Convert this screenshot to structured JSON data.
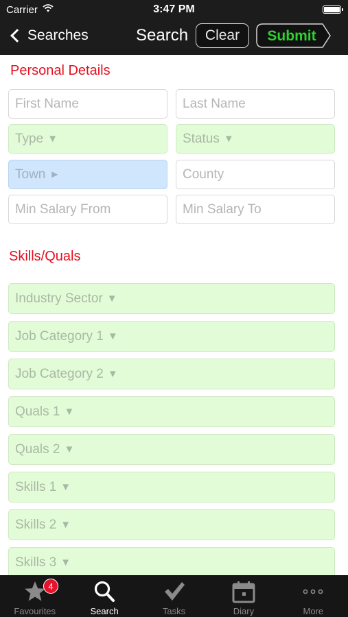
{
  "status_bar": {
    "carrier": "Carrier",
    "time": "3:47 PM"
  },
  "nav": {
    "back_label": "Searches",
    "title": "Search",
    "clear_label": "Clear",
    "submit_label": "Submit"
  },
  "personal": {
    "heading": "Personal Details",
    "first_name_placeholder": "First Name",
    "last_name_placeholder": "Last Name",
    "type_label": "Type",
    "status_label": "Status",
    "town_label": "Town",
    "county_placeholder": "County",
    "min_salary_from_placeholder": "Min Salary From",
    "min_salary_to_placeholder": "Min Salary To"
  },
  "skills": {
    "heading": "Skills/Quals",
    "items": [
      {
        "label": "Industry Sector"
      },
      {
        "label": "Job Category 1"
      },
      {
        "label": "Job Category 2"
      },
      {
        "label": "Quals 1"
      },
      {
        "label": "Quals 2"
      },
      {
        "label": "Skills 1"
      },
      {
        "label": "Skills 2"
      },
      {
        "label": "Skills 3"
      }
    ]
  },
  "tabbar": {
    "favourites": "Favourites",
    "favourites_badge": "4",
    "search": "Search",
    "tasks": "Tasks",
    "diary": "Diary",
    "more": "More"
  },
  "colors": {
    "accent_red": "#e4101f",
    "submit_green": "#2fd12f",
    "dropdown_green": "#e3fcd8",
    "town_blue": "#cfe6fc",
    "bar_bg": "#1c1c1c"
  },
  "icons": [
    "wifi-icon",
    "battery-icon",
    "back-chevron-icon",
    "star-icon",
    "magnifier-icon",
    "checkmark-icon",
    "calendar-icon",
    "more-dots-icon"
  ]
}
